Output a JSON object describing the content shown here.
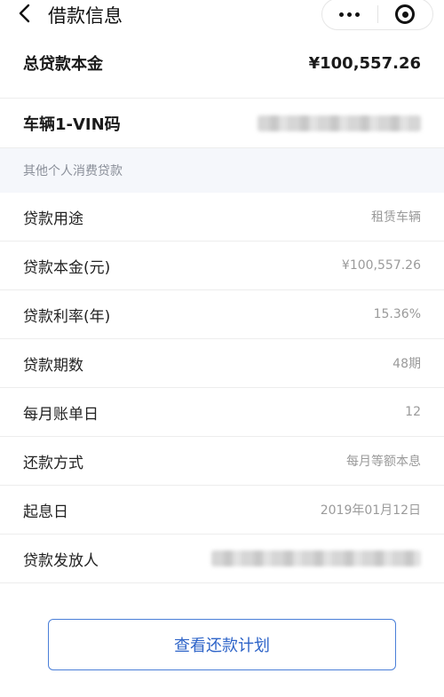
{
  "header": {
    "title": "借款信息",
    "back_icon": "chevron-left-icon",
    "more_icon": "more-icon",
    "close_icon": "target-close-icon"
  },
  "summary": [
    {
      "label": "总贷款本金",
      "value": "¥100,557.26"
    },
    {
      "label": "车辆1-VIN码",
      "value": null,
      "blurred": true
    }
  ],
  "section": {
    "title": "其他个人消费贷款",
    "rows": [
      {
        "label": "贷款用途",
        "value": "租赁车辆"
      },
      {
        "label": "贷款本金(元)",
        "value": "¥100,557.26"
      },
      {
        "label": "贷款利率(年)",
        "value": "15.36%"
      },
      {
        "label": "贷款期数",
        "value": "48期"
      },
      {
        "label": "每月账单日",
        "value": "12"
      },
      {
        "label": "还款方式",
        "value": "每月等额本息"
      },
      {
        "label": "起息日",
        "value": "2019年01月12日"
      },
      {
        "label": "贷款发放人",
        "value": null,
        "blurred": true
      }
    ]
  },
  "action": {
    "label": "查看还款计划"
  },
  "colors": {
    "accent": "#2e64c8",
    "section_bg": "#f5f7fb"
  }
}
